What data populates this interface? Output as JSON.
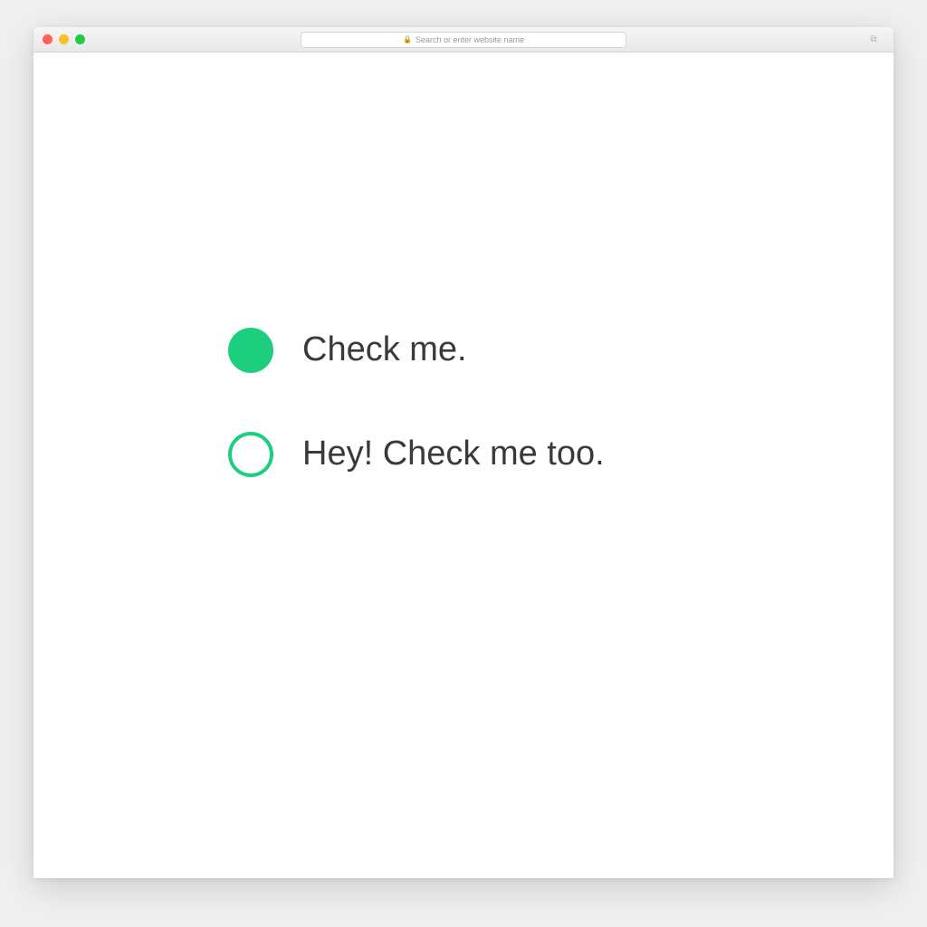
{
  "browser": {
    "address_text": "Search or enter website name"
  },
  "options": [
    {
      "label": "Check me.",
      "checked": true
    },
    {
      "label": "Hey! Check me too.",
      "checked": false
    }
  ],
  "colors": {
    "accent": "#1ece7f"
  }
}
